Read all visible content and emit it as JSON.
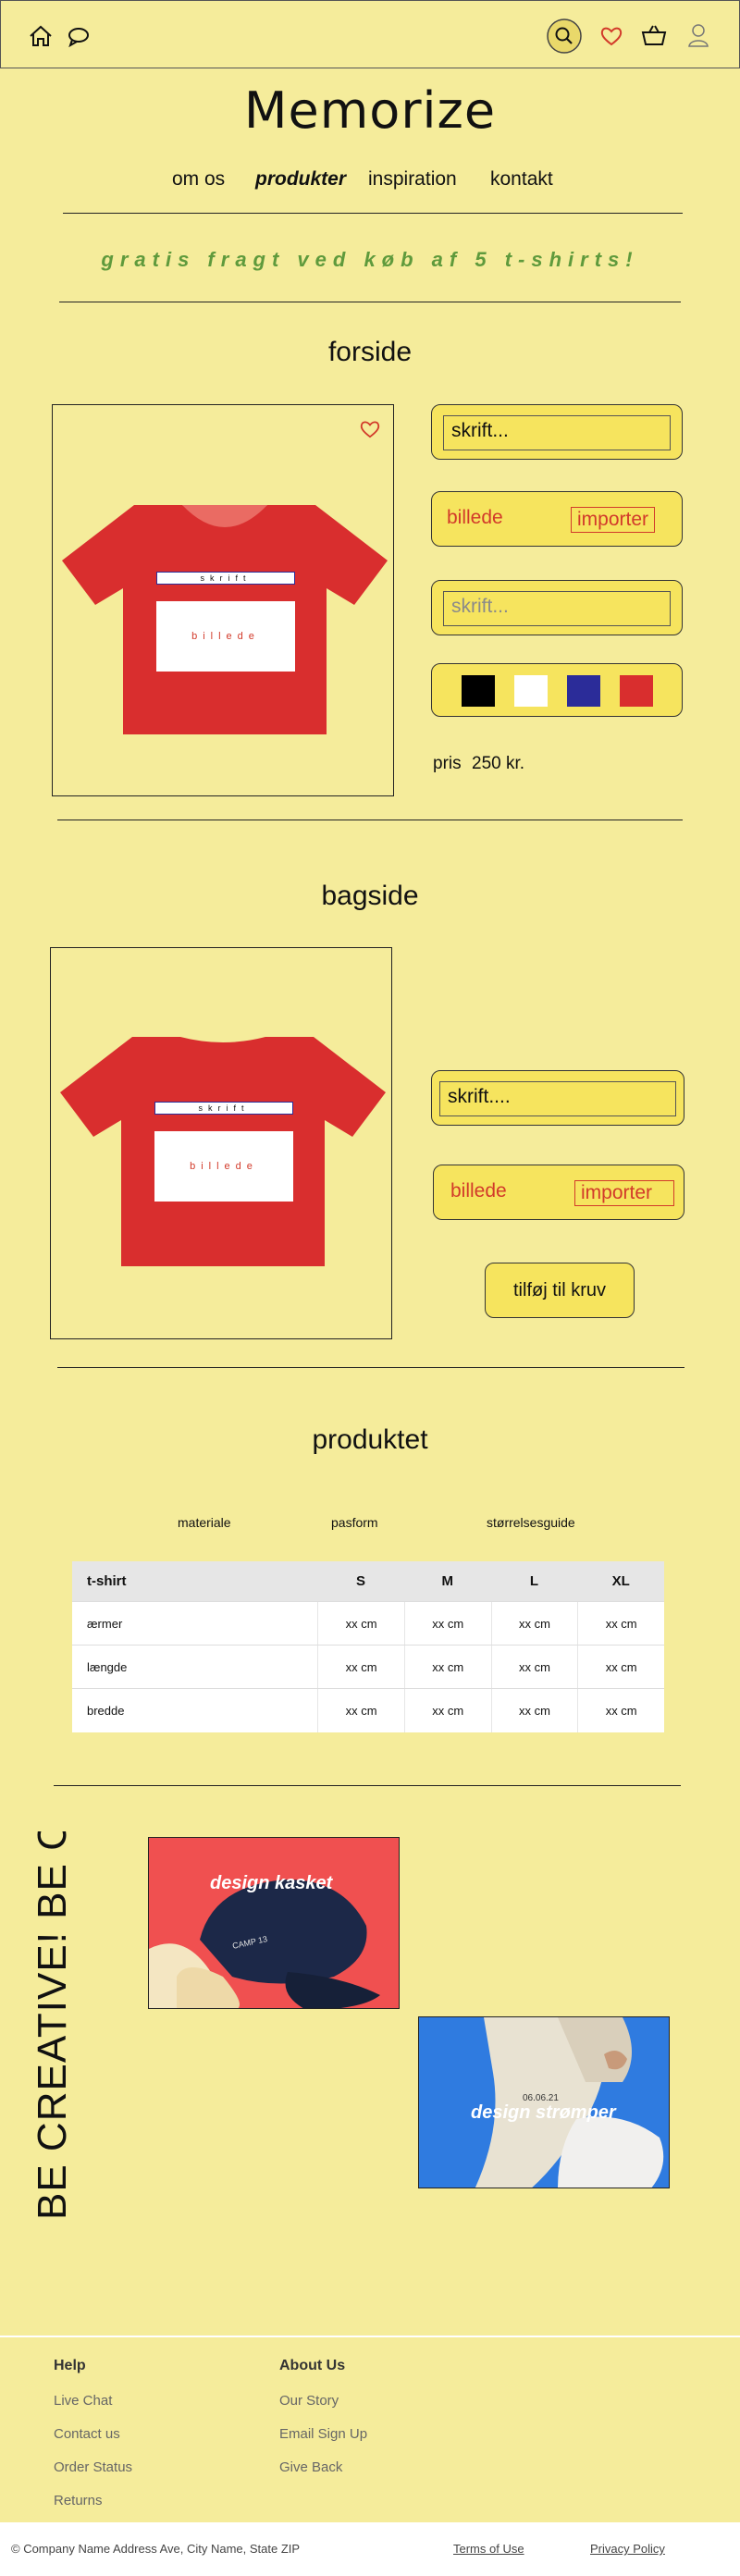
{
  "header": {
    "icons": [
      "home-icon",
      "chat-icon",
      "search-icon",
      "heart-icon",
      "basket-icon",
      "user-icon"
    ]
  },
  "brand": {
    "logo_text": "Memorize"
  },
  "nav": {
    "items": [
      "om os",
      "produkter",
      "inspiration",
      "kontakt"
    ],
    "active": "produkter"
  },
  "promo": {
    "text": "gratis fragt ved køb af 5 t-shirts!"
  },
  "front": {
    "heading": "forside",
    "tshirt": {
      "text_label": "skrift",
      "image_label": "billede"
    },
    "text_input_value": "skrift...",
    "image_label": "billede",
    "import_label": "importer",
    "text_input2_placeholder": "skrift...",
    "colors": [
      "#000000",
      "#ffffff",
      "#2b2c99",
      "#d92e2e"
    ],
    "price_label": "pris",
    "price_value": "250 kr."
  },
  "back": {
    "heading": "bagside",
    "tshirt": {
      "text_label": "skrift",
      "image_label": "billede"
    },
    "text_input_value": "skrift....",
    "image_label": "billede",
    "import_label": "importer",
    "add_to_cart": "tilføj til kruv"
  },
  "product": {
    "heading": "produktet",
    "tabs": [
      "materiale",
      "pasform",
      "størrelsesguide"
    ],
    "table": {
      "columns": [
        "t-shirt",
        "S",
        "M",
        "L",
        "XL"
      ],
      "rows": [
        {
          "label": "ærmer",
          "cells": [
            "xx cm",
            "xx cm",
            "xx cm",
            "xx cm"
          ]
        },
        {
          "label": "længde",
          "cells": [
            "xx cm",
            "xx cm",
            "xx cm",
            "xx cm"
          ]
        },
        {
          "label": "bredde",
          "cells": [
            "xx cm",
            "xx cm",
            "xx cm",
            "xx cm"
          ]
        }
      ]
    }
  },
  "inspiration": {
    "vertical_text": "BE CREATIVE! BE C",
    "cards": [
      {
        "label": "design kasket",
        "cap_text": "CAMP 13",
        "bg": "#f05050"
      },
      {
        "label": "design strømper",
        "sock_text": "06.06.21",
        "bg": "#2f7be0"
      }
    ]
  },
  "footer": {
    "help": {
      "heading": "Help",
      "links": [
        "Live Chat",
        "Contact us",
        "Order Status",
        "Returns"
      ]
    },
    "about": {
      "heading": "About Us",
      "links": [
        "Our Story",
        "Email Sign Up",
        "Give Back"
      ]
    },
    "copyright": "© Company Name Address Ave, City Name, State ZIP",
    "terms": "Terms of Use",
    "privacy": "Privacy Policy"
  }
}
